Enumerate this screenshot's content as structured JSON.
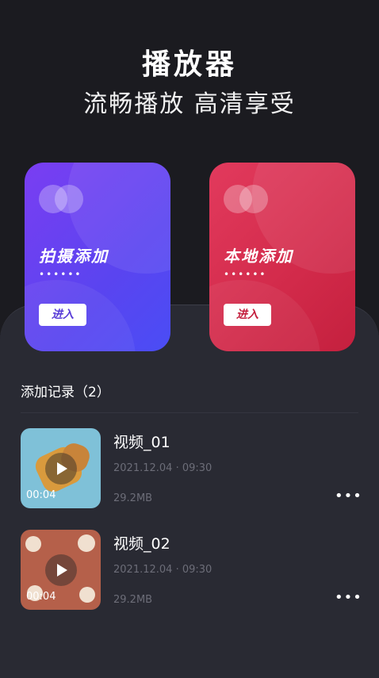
{
  "header": {
    "title": "播放器",
    "subtitle": "流畅播放 高清享受"
  },
  "cards": [
    {
      "label": "拍摄添加",
      "dots": "••••••",
      "button": "进入",
      "color": "#5a44f0"
    },
    {
      "label": "本地添加",
      "dots": "••••••",
      "button": "进入",
      "color": "#d22a4a"
    }
  ],
  "history": {
    "title": "添加记录（2）",
    "items": [
      {
        "name": "视频_01",
        "date": "2021.12.04 · 09:30",
        "size": "29.2MB",
        "duration": "00:04",
        "more": "•••"
      },
      {
        "name": "视频_02",
        "date": "2021.12.04 · 09:30",
        "size": "29.2MB",
        "duration": "00:04",
        "more": "•••"
      }
    ]
  },
  "icons": [
    "play-icon",
    "more-icon",
    "card-circles-icon"
  ]
}
